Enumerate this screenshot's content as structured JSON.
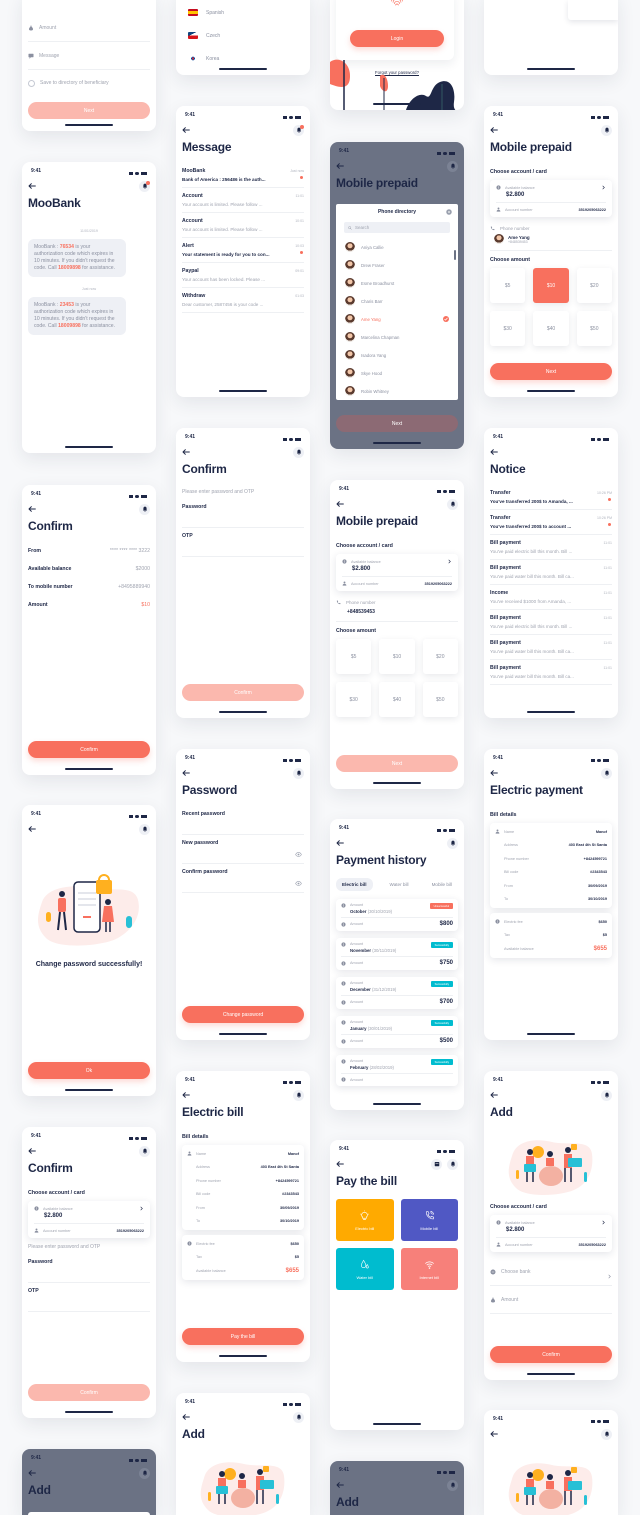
{
  "colors": {
    "accent": "#f8705e",
    "accent_disabled": "#fbb8ae",
    "text": "#1e2746",
    "muted": "#a0a4b0",
    "overlay": "#6b7284",
    "electric": "#ffaa00",
    "mobile": "#5058c4",
    "water": "#00bccf",
    "internet": "#f7807a"
  },
  "screens": [
    {
      "partial": "top",
      "blocks": [
        {
          "type": "field",
          "icon": "money-bag",
          "placeholder": "Amount"
        },
        {
          "type": "field",
          "icon": "message",
          "placeholder": "Message"
        },
        {
          "type": "check",
          "label": "Save to directory of beneficiary"
        },
        {
          "type": "button",
          "label": "Next",
          "disabled": true
        }
      ]
    },
    {
      "partial": "top",
      "blocks": [
        {
          "type": "langs",
          "items": [
            {
              "flag": "spain",
              "name": "Spanish"
            },
            {
              "flag": "czech",
              "name": "Czech"
            },
            {
              "flag": "korea",
              "name": "Korea"
            }
          ]
        }
      ]
    },
    {
      "partial": "top",
      "blocks": [
        {
          "type": "login",
          "button": "Login",
          "link": "Forgot your password?"
        }
      ]
    },
    {
      "partial": "top",
      "blocks": [
        {
          "type": "chips"
        }
      ]
    },
    {
      "time": "9:41",
      "nav": [
        "bell-badge"
      ],
      "title": "MooBank",
      "blocks": [
        {
          "type": "chat",
          "messages": [
            {
              "date": "11/01/2019",
              "parts": [
                {
                  "t": "MooBank : "
                },
                {
                  "t": "76534",
                  "h": true
                },
                {
                  "t": " is your authorization code which expires in 10 minutes. If you didn't request the code. Call "
                },
                {
                  "t": "18009898",
                  "h": true
                },
                {
                  "t": " for assistance."
                }
              ]
            },
            {
              "date": "Just now",
              "parts": [
                {
                  "t": "MooBank : "
                },
                {
                  "t": "23453",
                  "h": true
                },
                {
                  "t": " is your authorization code which expires in 10 minutes. If you didn't request the code. Call "
                },
                {
                  "t": "18009898",
                  "h": true
                },
                {
                  "t": " for assistance."
                }
              ]
            }
          ]
        }
      ]
    },
    {
      "time": "9:41",
      "nav": [
        "bell-badge"
      ],
      "title": "Message",
      "blocks": [
        {
          "type": "msglist",
          "items": [
            {
              "title": "MooBank",
              "time": "Just now",
              "preview": "Bank of America : 256486 is the auth...",
              "unread": true
            },
            {
              "title": "Account",
              "time": "11:01",
              "preview": "Your account is limited. Please follow ...",
              "unread": false
            },
            {
              "title": "Account",
              "time": "10:01",
              "preview": "Your account is limited. Please follow ...",
              "unread": false
            },
            {
              "title": "Alert",
              "time": "10:03",
              "preview": "Your statement is ready for you to con...",
              "unread": true
            },
            {
              "title": "Paypal",
              "time": "09:01",
              "preview": "Your account has been locked. Please ...",
              "unread": false
            },
            {
              "title": "Withdraw",
              "time": "01:03",
              "preview": "Dear customer, 2587456 is your code ...",
              "unread": false
            }
          ]
        }
      ]
    },
    {
      "dark": true,
      "time": "9:41",
      "nav": [
        "bell"
      ],
      "title": "Mobile prepaid",
      "blocks": [
        {
          "type": "directory",
          "title": "Phone directory",
          "search_placeholder": "Search",
          "selected": "Ame Yang",
          "contacts": [
            "Aniya Callie",
            "Drew Fraser",
            "Esme Broadhurst",
            "Charis Barr",
            "Ame Yang",
            "Marcelina Chapman",
            "Isadora Yang",
            "Skye Hood",
            "Robin Whitney"
          ]
        },
        {
          "type": "button",
          "label": "Next",
          "disabled": true
        }
      ]
    },
    {
      "time": "9:41",
      "nav": [
        "bell"
      ],
      "title": "Mobile prepaid",
      "blocks": [
        {
          "type": "label",
          "text": "Choose account / card"
        },
        {
          "type": "account",
          "balance_label": "Available balance",
          "balance": "$2.800",
          "account_label": "Account number",
          "account": "3519205063222"
        },
        {
          "type": "phone",
          "label": "Phone number",
          "contact": {
            "name": "Ame Yang",
            "number": "+848539453"
          }
        },
        {
          "type": "label",
          "text": "Choose amount"
        },
        {
          "type": "amounts",
          "options": [
            "$5",
            "$10",
            "$20",
            "$30",
            "$40",
            "$50"
          ],
          "selected": "$10"
        },
        {
          "type": "button",
          "label": "Next",
          "disabled": false
        }
      ]
    },
    {
      "time": "9:41",
      "nav": [
        "bell"
      ],
      "title": "Confirm",
      "blocks": [
        {
          "type": "kv",
          "rows": [
            {
              "label": "From",
              "value": "**** **** **** 3222"
            },
            {
              "label": "Available balance",
              "value": "$2000"
            },
            {
              "label": "To mobile number",
              "value": "+8495889940"
            },
            {
              "label": "Amount",
              "value": "$10",
              "accent": true
            }
          ]
        },
        {
          "type": "button",
          "label": "Confirm",
          "disabled": false
        }
      ]
    },
    {
      "time": "9:41",
      "nav": [
        "bell"
      ],
      "title": "Confirm",
      "blocks": [
        {
          "type": "hint",
          "text": "Please enter password and OTP"
        },
        {
          "type": "ff",
          "label": "Password"
        },
        {
          "type": "ff",
          "label": "OTP"
        },
        {
          "type": "button",
          "label": "Confirm",
          "disabled": true
        }
      ]
    },
    {
      "time": "9:41",
      "nav": [
        "bell"
      ],
      "title": "Mobile prepaid",
      "blocks": [
        {
          "type": "label",
          "text": "Choose account / card"
        },
        {
          "type": "account",
          "balance_label": "Available balance",
          "balance": "$2.800",
          "account_label": "Account number",
          "account": "3519205063222"
        },
        {
          "type": "phone",
          "label": "Phone number",
          "value": "+848539453"
        },
        {
          "type": "label",
          "text": "Choose amount"
        },
        {
          "type": "amounts",
          "options": [
            "$5",
            "$10",
            "$20",
            "$30",
            "$40",
            "$50"
          ],
          "selected": ""
        },
        {
          "type": "button",
          "label": "Next",
          "disabled": true
        }
      ]
    },
    {
      "time": "9:41",
      "nav": [],
      "title": "Notice",
      "blocks": [
        {
          "type": "msglist",
          "items": [
            {
              "title": "Transfer",
              "time": "10:26 PM",
              "preview": "You've transferred 200$ to Amanda, ...",
              "unread": true
            },
            {
              "title": "Transfer",
              "time": "10:26 PM",
              "preview": "You've transferred 200$ to account ...",
              "unread": true
            },
            {
              "title": "Bill payment",
              "time": "11:01",
              "preview": "You've paid electric bill this month. Bill ...",
              "unread": false
            },
            {
              "title": "Bill payment",
              "time": "11:01",
              "preview": "You've paid water bill this month. Bill ca...",
              "unread": false
            },
            {
              "title": "Income",
              "time": "11:01",
              "preview": "You've received $1000 from Amanda, ...",
              "unread": false
            },
            {
              "title": "Bill payment",
              "time": "11:01",
              "preview": "You've paid electric bill this month. Bill ...",
              "unread": false
            },
            {
              "title": "Bill payment",
              "time": "11:01",
              "preview": "You've paid water bill this month. Bill ca...",
              "unread": false
            },
            {
              "title": "Bill payment",
              "time": "11:01",
              "preview": "You've paid water bill this month. Bill ca...",
              "unread": false
            }
          ]
        }
      ]
    },
    {
      "time": "9:41",
      "nav": [
        "bell"
      ],
      "title": "",
      "blocks": [
        {
          "type": "illus",
          "kind": "padlock"
        },
        {
          "type": "success",
          "text": "Change password successfully!"
        },
        {
          "type": "button",
          "label": "Ok",
          "disabled": false
        }
      ]
    },
    {
      "time": "9:41",
      "nav": [
        "bell"
      ],
      "title": "Password",
      "blocks": [
        {
          "type": "ff",
          "label": "Recent password"
        },
        {
          "type": "ff",
          "label": "New password",
          "eye": true
        },
        {
          "type": "ff",
          "label": "Confirm password",
          "eye": true
        },
        {
          "type": "button",
          "label": "Change password",
          "disabled": false
        }
      ]
    },
    {
      "time": "9:41",
      "nav": [
        "bell"
      ],
      "title": "Payment history",
      "blocks": [
        {
          "type": "tabs",
          "items": [
            "Electric bill",
            "Water bill",
            "Mobile bill"
          ],
          "active": "Electric bill"
        },
        {
          "type": "history",
          "items": [
            {
              "label": "Amount",
              "month": "October",
              "date": "(30/10/2019)",
              "status": "Unsuccessful",
              "failed": true,
              "amount_label": "Amount",
              "amount": "$800"
            },
            {
              "label": "Amount",
              "month": "November",
              "date": "(30/11/2019)",
              "status": "Successfully",
              "failed": false,
              "amount_label": "Amount",
              "amount": "$750"
            },
            {
              "label": "Amount",
              "month": "December",
              "date": "(31/12/2019)",
              "status": "Successfully",
              "failed": false,
              "amount_label": "Amount",
              "amount": "$700"
            },
            {
              "label": "Amount",
              "month": "January",
              "date": "(30/01/2019)",
              "status": "Successfully",
              "failed": false,
              "amount_label": "Amount",
              "amount": "$500"
            },
            {
              "label": "Amount",
              "month": "February",
              "date": "(28/02/2019)",
              "status": "Successfully",
              "failed": false,
              "amount_label": "Amount",
              "amount": ""
            }
          ]
        }
      ]
    },
    {
      "time": "9:41",
      "nav": [
        "bell"
      ],
      "title": "Electric payment",
      "blocks": [
        {
          "type": "label",
          "text": "Bill details"
        },
        {
          "type": "bill",
          "groups": [
            [
              {
                "icon": "user",
                "label": "Name",
                "value": "Manof"
              },
              {
                "label": "Address",
                "value": "403 East 4th St Santa"
              },
              {
                "label": "Phone number",
                "value": "+8424599721"
              },
              {
                "label": "Bill code",
                "value": "#2343543"
              },
              {
                "label": "From",
                "value": "30/09/2019"
              },
              {
                "label": "To",
                "value": "30/10/2019"
              }
            ],
            [
              {
                "icon": "coin",
                "label": "Electric fee",
                "value": "$650"
              },
              {
                "label": "Tax",
                "value": "$5"
              },
              {
                "label": "Available balance",
                "value": "$655",
                "accent": true
              }
            ]
          ]
        }
      ]
    },
    {
      "time": "9:41",
      "nav": [
        "bell"
      ],
      "title": "Confirm",
      "blocks": [
        {
          "type": "label",
          "text": "Choose account / card"
        },
        {
          "type": "account",
          "balance_label": "Available balance",
          "balance": "$2.800",
          "account_label": "Account number",
          "account": "3519205063222"
        },
        {
          "type": "hint",
          "text": "Please enter password and OTP"
        },
        {
          "type": "ff",
          "label": "Password"
        },
        {
          "type": "ff",
          "label": "OTP"
        },
        {
          "type": "button",
          "label": "Confirm",
          "disabled": true
        }
      ]
    },
    {
      "time": "9:41",
      "nav": [
        "bell"
      ],
      "title": "Electric bill",
      "blocks": [
        {
          "type": "label",
          "text": "Bill details"
        },
        {
          "type": "bill",
          "groups": [
            [
              {
                "icon": "user",
                "label": "Name",
                "value": "Manof"
              },
              {
                "label": "Address",
                "value": "403 East 4th St Santa"
              },
              {
                "label": "Phone number",
                "value": "+8424599721"
              },
              {
                "label": "Bill code",
                "value": "#2343543"
              },
              {
                "label": "From",
                "value": "30/09/2019"
              },
              {
                "label": "To",
                "value": "30/10/2019"
              }
            ],
            [
              {
                "icon": "coin",
                "label": "Electric fee",
                "value": "$650"
              },
              {
                "label": "Tax",
                "value": "$5"
              },
              {
                "label": "Available balance",
                "value": "$655",
                "accent": true
              }
            ]
          ]
        },
        {
          "type": "button",
          "label": "Pay the bill",
          "disabled": false
        }
      ]
    },
    {
      "time": "9:41",
      "nav": [
        "calendar",
        "bell"
      ],
      "title": "Pay the bill",
      "blocks": [
        {
          "type": "tiles",
          "items": [
            {
              "label": "Electric bill",
              "icon": "bulb",
              "color": "#ffaa00"
            },
            {
              "label": "Mobile bill",
              "icon": "phone",
              "color": "#5058c4"
            },
            {
              "label": "Water bill",
              "icon": "drop",
              "color": "#00bccf"
            },
            {
              "label": "Internet bill",
              "icon": "wifi",
              "color": "#f7807a"
            }
          ]
        }
      ]
    },
    {
      "time": "9:41",
      "nav": [
        "bell"
      ],
      "title": "Add",
      "blocks": [
        {
          "type": "illus",
          "kind": "piggy"
        },
        {
          "type": "label",
          "text": "Choose account / card"
        },
        {
          "type": "account",
          "balance_label": "Available balance",
          "balance": "$2.800",
          "account_label": "Account number",
          "account": "3519205063222"
        },
        {
          "type": "field",
          "icon": "bank",
          "placeholder": "Choose bank",
          "chevron": true
        },
        {
          "type": "field",
          "icon": "money-bag",
          "placeholder": "Amount"
        },
        {
          "type": "button",
          "label": "Confirm",
          "disabled": false
        }
      ]
    },
    {
      "dark": true,
      "time": "9:41",
      "nav": [
        "bell"
      ],
      "title": "Add",
      "blocks": [
        {
          "type": "darkcard"
        }
      ]
    },
    {
      "time": "9:41",
      "nav": [
        "bell"
      ],
      "title": "Add",
      "blocks": [
        {
          "type": "illus",
          "kind": "piggy"
        }
      ]
    },
    {
      "dark": true,
      "time": "9:41",
      "nav": [
        "bell"
      ],
      "title": "Add",
      "blocks": []
    },
    {
      "time": "9:41",
      "nav": [
        "bell"
      ],
      "title": "",
      "blocks": [
        {
          "type": "illus",
          "kind": "piggy"
        }
      ]
    }
  ]
}
